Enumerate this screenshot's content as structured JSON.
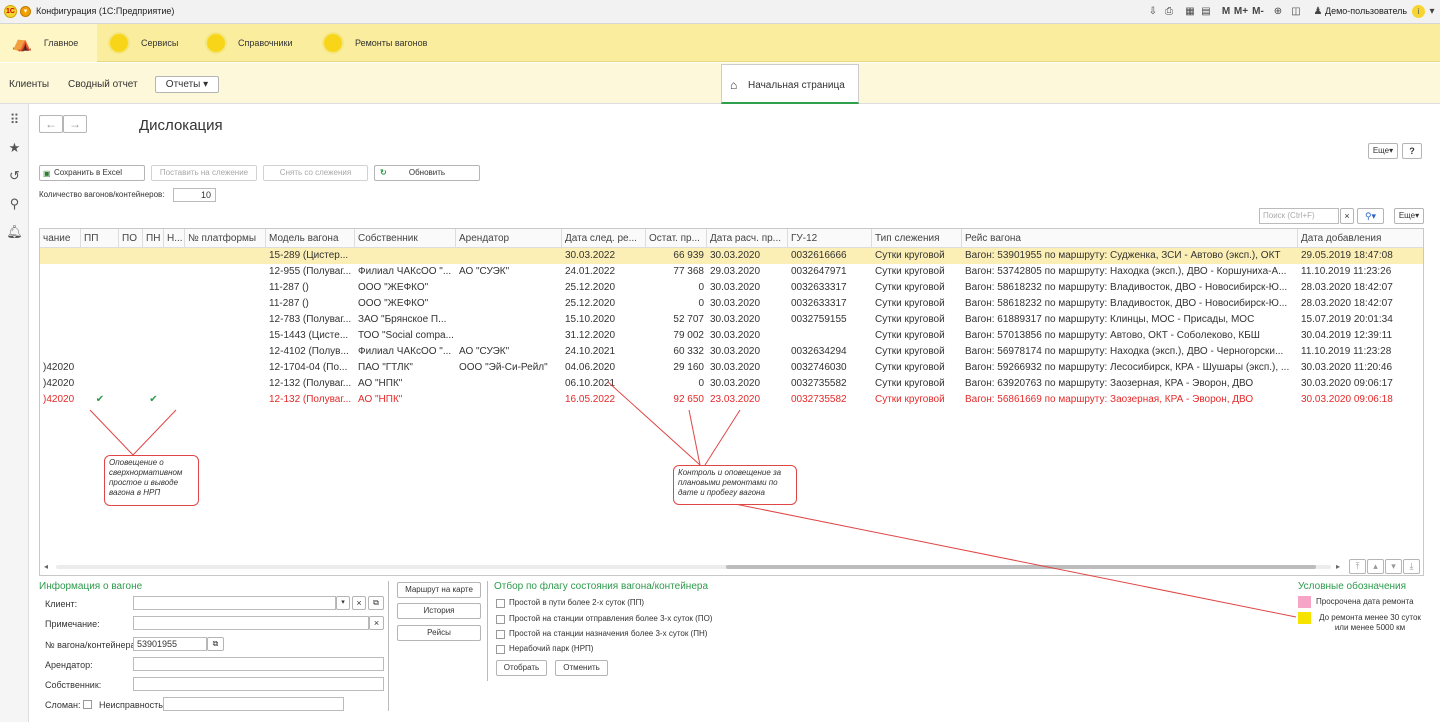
{
  "titlebar": {
    "title": "Конфигурация  (1С:Предприятие)",
    "user": "Демо-пользователь",
    "m_buttons": [
      "M",
      "M+",
      "M-"
    ]
  },
  "sections": [
    {
      "label": "Главное"
    },
    {
      "label": "Сервисы"
    },
    {
      "label": "Справочники"
    },
    {
      "label": "Ремонты вагонов"
    }
  ],
  "nav": {
    "clients": "Клиенты",
    "summary": "Сводный отчет",
    "reports": "Отчеты",
    "home_tab": "Начальная страница"
  },
  "page": {
    "title": "Дислокация",
    "more": "Еще",
    "help": "?"
  },
  "toolbar": {
    "save_excel": "Сохранить в Excel",
    "track": "Поставить на слежение",
    "untrack": "Снять со слежения",
    "refresh": "Обновить"
  },
  "count": {
    "label": "Количество вагонов/контейнеров:",
    "value": "10"
  },
  "search": {
    "placeholder": "Поиск (Ctrl+F)",
    "more": "Еще"
  },
  "table": {
    "columns": [
      "чание",
      "ПП",
      "ПО",
      "ПН",
      "Н...",
      "№ платформы",
      "Модель вагона",
      "Собственник",
      "Арендатор",
      "Дата след. ре...",
      "Остат. пр...",
      "Дата расч. пр...",
      "ГУ-12",
      "Тип слежения",
      "Рейс вагона",
      "Дата добавления"
    ],
    "rows": [
      {
        "note": "",
        "pp": "",
        "pn": "",
        "model": "15-289 (Цистер...",
        "owner": "",
        "lessee": "",
        "next": "30.03.2022",
        "rest": "66 939",
        "calc": "30.03.2020",
        "gu": "0032616666",
        "type": "Сутки круговой",
        "trip": "Вагон: 53901955 по маршруту: Судженка, ЗСИ - Автово (эксп.), ОКТ",
        "added": "29.05.2019 18:47:08"
      },
      {
        "note": "",
        "pp": "",
        "pn": "",
        "model": "12-955 (Полуваг...",
        "owner": "Филиал ЧАКсОО \"...",
        "lessee": "АО \"СУЭК\"",
        "next": "24.01.2022",
        "rest": "77 368",
        "calc": "29.03.2020",
        "gu": "0032647971",
        "type": "Сутки круговой",
        "trip": "Вагон: 53742805 по маршруту: Находка (эксп.), ДВО - Коршуниха-А...",
        "added": "11.10.2019 11:23:26"
      },
      {
        "note": "",
        "pp": "",
        "pn": "",
        "model": "11-287 ()",
        "owner": "ООО \"ЖЕФКО\"",
        "lessee": "",
        "next": "25.12.2020",
        "rest": "0",
        "calc": "30.03.2020",
        "gu": "0032633317",
        "type": "Сутки круговой",
        "trip": "Вагон: 58618232 по маршруту: Владивосток, ДВО - Новосибирск-Ю...",
        "added": "28.03.2020 18:42:07"
      },
      {
        "note": "",
        "pp": "",
        "pn": "",
        "model": "11-287 ()",
        "owner": "ООО \"ЖЕФКО\"",
        "lessee": "",
        "next": "25.12.2020",
        "rest": "0",
        "calc": "30.03.2020",
        "gu": "0032633317",
        "type": "Сутки круговой",
        "trip": "Вагон: 58618232 по маршруту: Владивосток, ДВО - Новосибирск-Ю...",
        "added": "28.03.2020 18:42:07"
      },
      {
        "note": "",
        "pp": "",
        "pn": "",
        "model": "12-783 (Полуваг...",
        "owner": "ЗАО \"Брянское П...",
        "lessee": "",
        "next": "15.10.2020",
        "rest": "52 707",
        "calc": "30.03.2020",
        "gu": "0032759155",
        "type": "Сутки круговой",
        "trip": "Вагон: 61889317 по маршруту: Клинцы, МОС - Присады, МОС",
        "added": "15.07.2019 20:01:34"
      },
      {
        "note": "",
        "pp": "",
        "pn": "",
        "model": "15-1443 (Цисте...",
        "owner": "ТОО \"Social compa...",
        "lessee": "",
        "next": "31.12.2020",
        "rest": "79 002",
        "calc": "30.03.2020",
        "gu": "",
        "type": "Сутки круговой",
        "trip": "Вагон: 57013856 по маршруту: Автово, ОКТ - Соболеково, КБШ",
        "added": "30.04.2019 12:39:11"
      },
      {
        "note": "",
        "pp": "",
        "pn": "",
        "model": "12-4102 (Полув...",
        "owner": "Филиал ЧАКсОО \"...",
        "lessee": "АО \"СУЭК\"",
        "next": "24.10.2021",
        "rest": "60 332",
        "calc": "30.03.2020",
        "gu": "0032634294",
        "type": "Сутки круговой",
        "trip": "Вагон: 56978174 по маршруту: Находка (эксп.), ДВО - Черногорски...",
        "added": "11.10.2019 11:23:28"
      },
      {
        "note": ")42020",
        "pp": "",
        "pn": "",
        "model": "12-1704-04 (По...",
        "owner": "ПАО \"ГТЛК\"",
        "lessee": "ООО \"Эй-Си-Рейл\"",
        "next": "04.06.2020",
        "rest": "29 160",
        "calc": "30.03.2020",
        "gu": "0032746030",
        "type": "Сутки круговой",
        "trip": "Вагон: 59266932 по маршруту: Лесосибирск, КРА - Шушары (эксп.), ...",
        "added": "30.03.2020 11:20:46"
      },
      {
        "note": ")42020",
        "pp": "",
        "pn": "",
        "model": "12-132 (Полуваг...",
        "owner": "АО \"НПК\"",
        "lessee": "",
        "next": "06.10.2021",
        "rest": "0",
        "calc": "30.03.2020",
        "gu": "0032735582",
        "type": "Сутки круговой",
        "trip": "Вагон: 63920763 по маршруту: Заозерная, КРА - Эворон, ДВО",
        "added": "30.03.2020 09:06:17"
      },
      {
        "note": ")42020",
        "pp": "✔",
        "pn": "✔",
        "model": "12-132 (Полуваг...",
        "owner": "АО \"НПК\"",
        "lessee": "",
        "next": "16.05.2022",
        "rest": "92 650",
        "calc": "23.03.2020",
        "gu": "0032735582",
        "type": "Сутки круговой",
        "trip": "Вагон: 56861669 по маршруту: Заозерная, КРА - Эворон, ДВО",
        "added": "30.03.2020 09:06:18"
      }
    ]
  },
  "callouts": {
    "left": "Оповещение о сверхнормативном простое и выводе вагона в НРП",
    "right": "Контроль и оповещение за плановыми ремонтами по дате и пробегу вагона"
  },
  "info": {
    "title": "Информация о вагоне",
    "client": "Клиент:",
    "note": "Примечание:",
    "wagon_label": "№ вагона/контейнера:",
    "wagon_value": "53901955",
    "lessee": "Арендатор:",
    "owner": "Собственник:",
    "broken": "Сломан:",
    "fault": "Неисправность:"
  },
  "side_buttons": {
    "route": "Маршрут на карте",
    "history": "История",
    "trips": "Рейсы"
  },
  "filter": {
    "title": "Отбор по флагу состояния вагона/контейнера",
    "items": [
      "Простой в пути более 2-х суток (ПП)",
      "Простой на станции отправления более 3-х суток (ПО)",
      "Простой на станции назначения более 3-х суток (ПН)",
      "Нерабочий парк (НРП)"
    ],
    "apply": "Отобрать",
    "cancel": "Отменить"
  },
  "legend": {
    "title": "Условные обозначения",
    "overdue": "Просрочена дата ремонта",
    "soon": "До ремонта менее 30 суток или менее 5000 км",
    "colors": {
      "overdue": "#f7a5c6",
      "soon": "#f7e300"
    }
  },
  "colors": {
    "accent": "#2e9a4c",
    "section_bar": "#fbed9e",
    "highlight_row": "#fbefb6",
    "alert": "#e52a2a"
  }
}
